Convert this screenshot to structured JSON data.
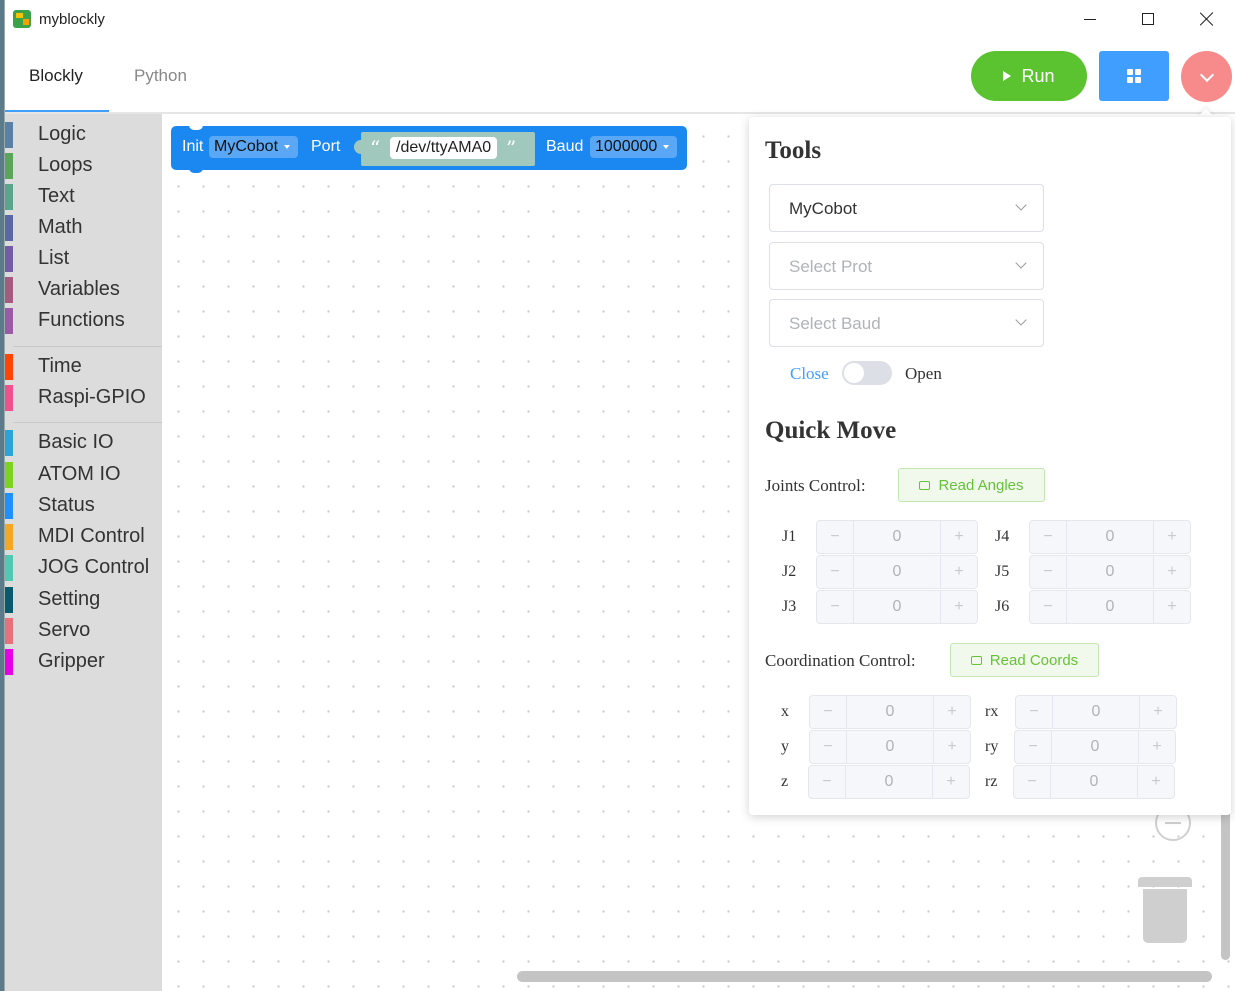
{
  "window": {
    "title": "myblockly"
  },
  "header": {
    "tabs": [
      "Blockly",
      "Python"
    ],
    "run_label": "Run",
    "colors": {
      "run": "#5bc230",
      "grid": "#409eff",
      "menu": "#f78a8a"
    }
  },
  "toolbox": {
    "groups": [
      [
        {
          "label": "Logic",
          "color": "#5b80a5"
        },
        {
          "label": "Loops",
          "color": "#5ba55b"
        },
        {
          "label": "Text",
          "color": "#5ba58c"
        },
        {
          "label": "Math",
          "color": "#5b67a5"
        },
        {
          "label": "List",
          "color": "#745ba5"
        },
        {
          "label": "Variables",
          "color": "#a55b80"
        },
        {
          "label": "Functions",
          "color": "#995ba5"
        }
      ],
      [
        {
          "label": "Time",
          "color": "#ff4500"
        },
        {
          "label": "Raspi-GPIO",
          "color": "#f0508c"
        }
      ],
      [
        {
          "label": "Basic IO",
          "color": "#2aa3d8"
        },
        {
          "label": "ATOM IO",
          "color": "#7ed321"
        },
        {
          "label": "Status",
          "color": "#1e90ff"
        },
        {
          "label": "MDI Control",
          "color": "#f5a623"
        },
        {
          "label": "JOG Control",
          "color": "#50c8b4"
        },
        {
          "label": "Setting",
          "color": "#0a5a6e"
        },
        {
          "label": "Servo",
          "color": "#e8707a"
        },
        {
          "label": "Gripper",
          "color": "#e600e6"
        }
      ]
    ]
  },
  "block": {
    "init": "Init",
    "robot": "MyCobot",
    "port_label": "Port",
    "port_value": "/dev/ttyAMA0",
    "baud_label": "Baud",
    "baud_value": "1000000",
    "quote_open": "“",
    "quote_close": "”"
  },
  "tools": {
    "title": "Tools",
    "robot_select": "MyCobot",
    "port_placeholder": "Select Prot",
    "baud_placeholder": "Select Baud",
    "switch_off": "Close",
    "switch_on": "Open"
  },
  "quick_move": {
    "title": "Quick Move",
    "joints_label": "Joints Control:",
    "read_angles": "Read Angles",
    "joints": [
      {
        "name": "J1",
        "value": "0"
      },
      {
        "name": "J2",
        "value": "0"
      },
      {
        "name": "J3",
        "value": "0"
      },
      {
        "name": "J4",
        "value": "0"
      },
      {
        "name": "J5",
        "value": "0"
      },
      {
        "name": "J6",
        "value": "0"
      }
    ],
    "coords_label": "Coordination Control:",
    "read_coords": "Read Coords",
    "coords": [
      {
        "name": "x",
        "value": "0"
      },
      {
        "name": "y",
        "value": "0"
      },
      {
        "name": "z",
        "value": "0"
      },
      {
        "name": "rx",
        "value": "0"
      },
      {
        "name": "ry",
        "value": "0"
      },
      {
        "name": "rz",
        "value": "0"
      }
    ],
    "minus": "−",
    "plus": "+"
  }
}
